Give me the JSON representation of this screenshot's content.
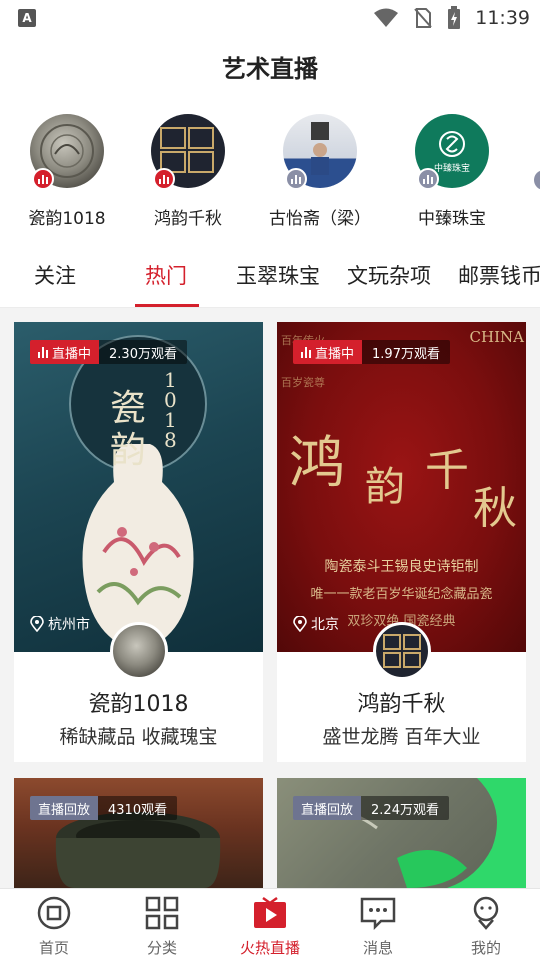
{
  "status_bar": {
    "time": "11:39"
  },
  "header": {
    "title": "艺术直播"
  },
  "anchors": [
    {
      "name": "瓷韵1018",
      "live": true
    },
    {
      "name": "鸿韵千秋",
      "live": true
    },
    {
      "name": "古怡斋（梁）",
      "live": false
    },
    {
      "name": "中臻珠宝",
      "live": false
    }
  ],
  "tabs": [
    "关注",
    "热门",
    "玉翠珠宝",
    "文玩杂项",
    "邮票钱币"
  ],
  "active_tab": "热门",
  "cards": [
    {
      "state": "直播中",
      "views": "2.30万观看",
      "location": "杭州市",
      "title": "瓷韵1018",
      "subtitle": "稀缺藏品 收藏瑰宝",
      "poster_text": {
        "big": "瓷韵",
        "num": "1018"
      }
    },
    {
      "state": "直播中",
      "views": "1.97万观看",
      "location": "北京",
      "title": "鸿韵千秋",
      "subtitle": "盛世龙腾 百年大业",
      "poster_text": {
        "line1": "鸿",
        "line2": "韵",
        "line3": "千",
        "line4": "秋",
        "caption1": "陶瓷泰斗王锡良史诗钜制",
        "caption2": "唯一一款老百岁华诞纪念藏品瓷",
        "caption3": "双珍双绝 国瓷经典",
        "corner": "CHINA",
        "top1": "百年传火",
        "top2": "百岁瓷尊"
      }
    },
    {
      "state": "直播回放",
      "views": "4310观看"
    },
    {
      "state": "直播回放",
      "views": "2.24万观看"
    }
  ],
  "anchor_logo_text": "中臻珠宝",
  "nav": [
    {
      "label": "首页",
      "icon": "home-icon"
    },
    {
      "label": "分类",
      "icon": "grid-icon"
    },
    {
      "label": "火热直播",
      "icon": "play-icon"
    },
    {
      "label": "消息",
      "icon": "message-icon"
    },
    {
      "label": "我的",
      "icon": "profile-icon"
    }
  ],
  "colors": {
    "accent": "#d4202c",
    "replay": "#6e7490"
  }
}
